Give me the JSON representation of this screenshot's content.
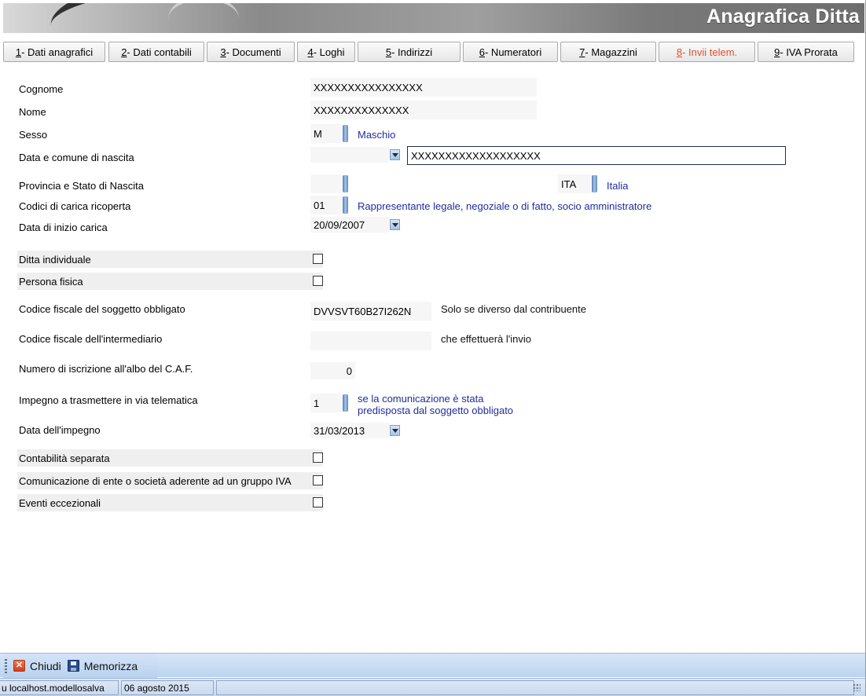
{
  "header": {
    "title": "Anagrafica Ditta"
  },
  "tabs": [
    {
      "num": "1",
      "label": " - Dati anagrafici",
      "active": false
    },
    {
      "num": "2",
      "label": " - Dati contabili",
      "active": false
    },
    {
      "num": "3",
      "label": " - Documenti",
      "active": false
    },
    {
      "num": "4",
      "label": " - Loghi",
      "active": false
    },
    {
      "num": "5",
      "label": " - Indirizzi",
      "active": false
    },
    {
      "num": "6",
      "label": " - Numeratori",
      "active": false
    },
    {
      "num": "7",
      "label": " - Magazzini",
      "active": false
    },
    {
      "num": "8",
      "label": " - Invii telem.",
      "active": true
    },
    {
      "num": "9",
      "label": " - IVA Prorata",
      "active": false
    }
  ],
  "form": {
    "cognome": {
      "label": "Cognome",
      "value": "XXXXXXXXXXXXXXXX"
    },
    "nome": {
      "label": "Nome",
      "value": "XXXXXXXXXXXXXX"
    },
    "sesso": {
      "label": "Sesso",
      "value": "M",
      "desc": "Maschio"
    },
    "nascita": {
      "label": "Data e comune di nascita",
      "date": "",
      "comune": "XXXXXXXXXXXXXXXXXXX"
    },
    "provincia": {
      "label": "Provincia e Stato di Nascita",
      "provincia": "",
      "stato": "ITA",
      "stato_desc": "Italia"
    },
    "carica": {
      "label": "Codici di carica ricoperta",
      "value": "01",
      "desc": "Rappresentante legale, negoziale o di fatto, socio amministratore"
    },
    "inizio_carica": {
      "label": "Data di inizio carica",
      "value": "20/09/2007"
    },
    "ditta_individuale": {
      "label": "Ditta individuale",
      "checked": false
    },
    "persona_fisica": {
      "label": "Persona fisica",
      "checked": false
    },
    "cf_obbligato": {
      "label": "Codice fiscale del soggetto obbligato",
      "value": "DVVSVT60B27I262N",
      "note": "Solo se diverso dal contribuente"
    },
    "cf_intermediario": {
      "label": "Codice fiscale dell'intermediario",
      "value": "",
      "note": "che effettuerà l'invio"
    },
    "caf": {
      "label": "Numero di iscrizione all'albo del C.A.F.",
      "value": "0"
    },
    "impegno": {
      "label": "Impegno a trasmettere in via telematica",
      "value": "1",
      "desc_line1": "se la comunicazione è stata",
      "desc_line2": "predisposta dal soggetto obbligato"
    },
    "data_impegno": {
      "label": "Data dell'impegno",
      "value": "31/03/2013"
    },
    "contabilita_separata": {
      "label": "Contabilità separata",
      "checked": false
    },
    "gruppo_iva": {
      "label": "Comunicazione di ente o società aderente ad un gruppo IVA",
      "checked": false
    },
    "eventi": {
      "label": "Eventi eccezionali",
      "checked": false
    }
  },
  "toolbar": {
    "close_label": "Chiudi",
    "save_label": "Memorizza"
  },
  "status": {
    "connection": "u localhost.modellosalva",
    "date": "06 agosto 2015",
    "extra": ""
  },
  "colors": {
    "active_tab": "#e0512a",
    "desc_text": "#1f2d9e",
    "toolbar_bg": "#c8daf1"
  }
}
